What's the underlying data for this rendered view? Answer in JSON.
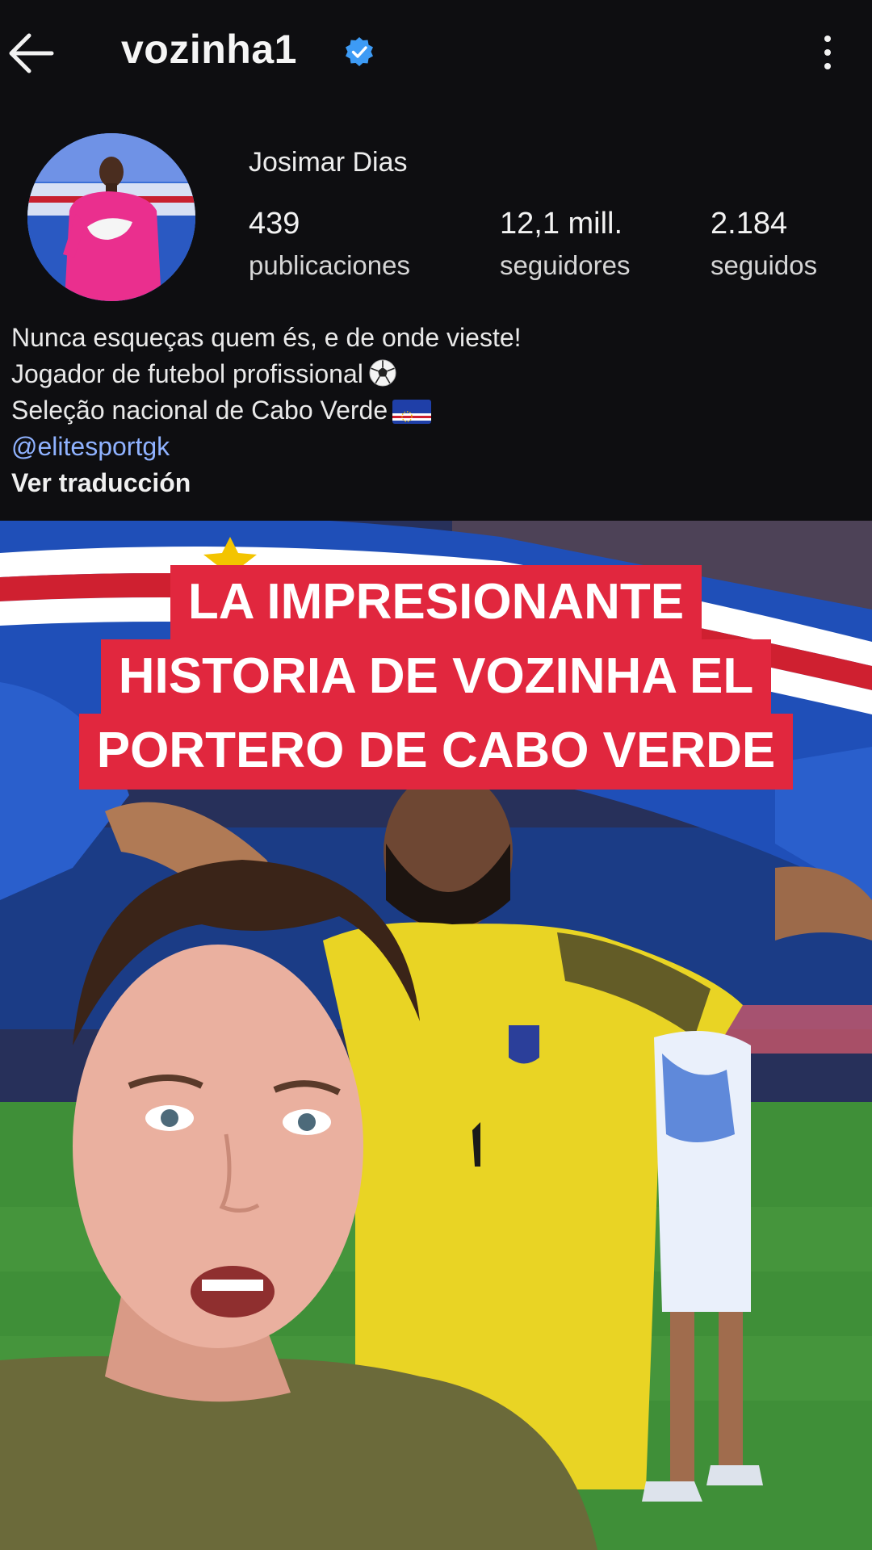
{
  "header": {
    "username": "vozinha1",
    "back_icon": "arrow-left-icon",
    "verified_icon": "verified-badge-icon",
    "more_icon": "more-vertical-icon"
  },
  "profile": {
    "display_name": "Josimar Dias",
    "stats": [
      {
        "value": "439",
        "label": "publicaciones"
      },
      {
        "value": "12,1 mill.",
        "label": "seguidores"
      },
      {
        "value": "2.184",
        "label": "seguidos"
      }
    ],
    "bio": {
      "line1": "Nunca esqueças quem és, e de onde vieste!",
      "line2": "Jogador de futebol profissional",
      "line3": "Seleção nacional de Cabo Verde",
      "link": "@elitesportgk",
      "translate": "Ver traducción"
    }
  },
  "video": {
    "headline": [
      "LA IMPRESIONANTE",
      "HISTORIA DE VOZINHA EL",
      "PORTERO DE CABO VERDE"
    ],
    "colors": {
      "caption_bg": "#e1273e",
      "caption_text": "#ffffff",
      "flag_blue": "#1f4fb8",
      "flag_red": "#cf2030",
      "jersey_yellow": "#e9d424",
      "pitch_green": "#3f8f38"
    }
  }
}
